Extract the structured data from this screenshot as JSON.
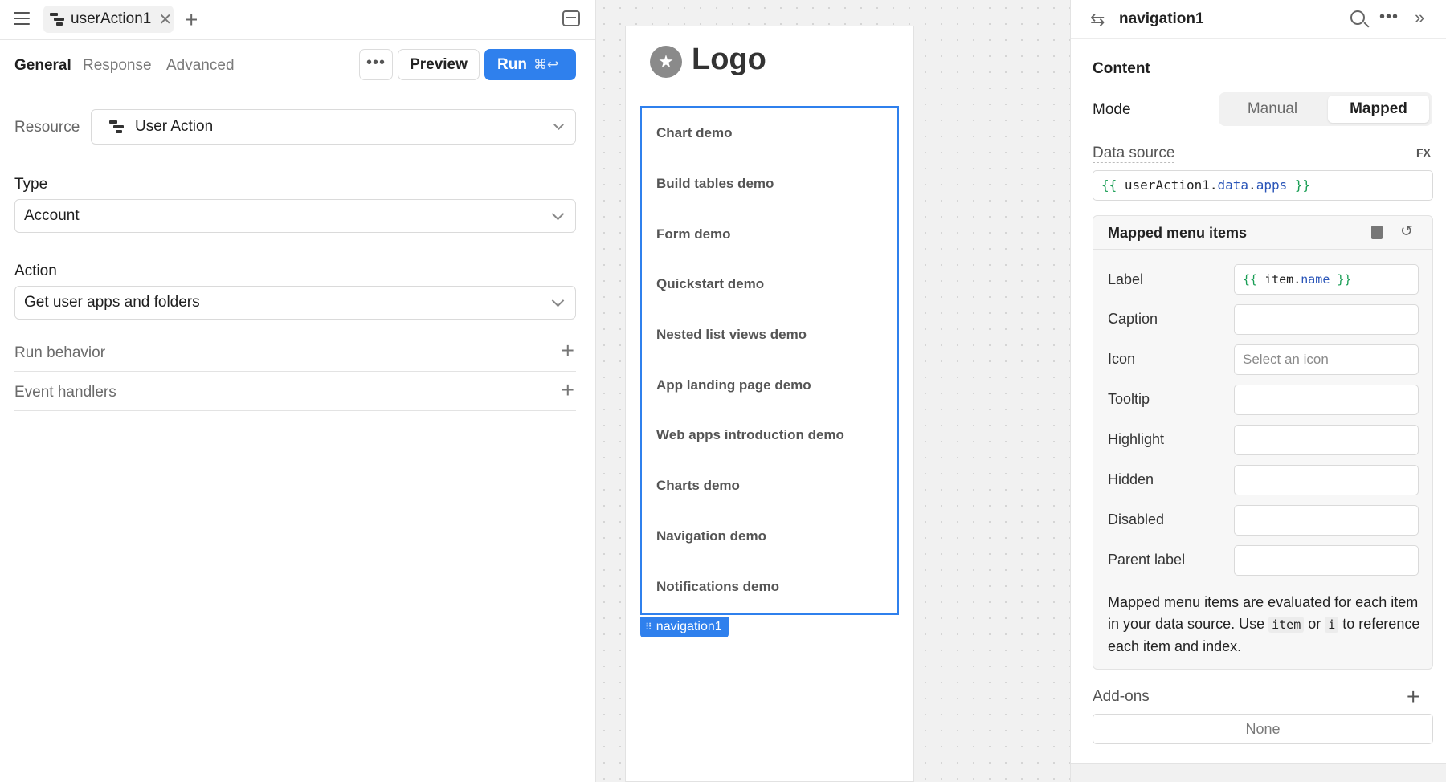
{
  "left_panel": {
    "file_tab": {
      "name": "userAction1",
      "close": "✕",
      "new_tab": "+"
    },
    "subtabs": [
      "General",
      "Response",
      "Advanced"
    ],
    "more_label": "•••",
    "preview_label": "Preview",
    "run_label": "Run",
    "run_shortcut": "⌘↩",
    "resource": {
      "label": "Resource",
      "value": "User Action"
    },
    "type": {
      "label": "Type",
      "value": "Account"
    },
    "action": {
      "label": "Action",
      "value": "Get user apps and folders"
    },
    "sections": [
      "Run behavior",
      "Event handlers"
    ]
  },
  "canvas": {
    "logo_text": "Logo",
    "logo_glyph": "★",
    "nav_items": [
      "Chart demo",
      "Build tables demo",
      "Form demo",
      "Quickstart demo",
      "Nested list views demo",
      "App landing page demo",
      "Web apps introduction demo",
      "Charts demo",
      "Navigation demo",
      "Notifications demo"
    ],
    "selected_tag": "navigation1",
    "selected_tag_grip": "⠿"
  },
  "inspector": {
    "title": "navigation1",
    "content_heading": "Content",
    "mode_label": "Mode",
    "mode_options": [
      "Manual",
      "Mapped"
    ],
    "mode_selected": "Mapped",
    "data_source_label": "Data source",
    "fx_label": "FX",
    "data_source": {
      "open": "{{",
      "id": "userAction1",
      "dot1": ".",
      "p1": "data",
      "dot2": ".",
      "p2": "apps",
      "close": "}}"
    },
    "mapped_heading": "Mapped menu items",
    "fields": [
      {
        "label": "Label",
        "value": "",
        "placeholder": ""
      },
      {
        "label": "Caption",
        "value": "",
        "placeholder": ""
      },
      {
        "label": "Icon",
        "value": "",
        "placeholder": "Select an icon"
      },
      {
        "label": "Tooltip",
        "value": "",
        "placeholder": ""
      },
      {
        "label": "Highlight",
        "value": "",
        "placeholder": ""
      },
      {
        "label": "Hidden",
        "value": "",
        "placeholder": ""
      },
      {
        "label": "Disabled",
        "value": "",
        "placeholder": ""
      },
      {
        "label": "Parent label",
        "value": "",
        "placeholder": ""
      }
    ],
    "label_code": {
      "open": "{{",
      "id": "item",
      "dot": ".",
      "prop": "name",
      "close": "}}"
    },
    "help": {
      "part1": "Mapped menu items are evaluated for each item in your data source. Use ",
      "code1": "item",
      "part2": " or ",
      "code2": "i",
      "part3": " to reference each item and index."
    },
    "addons_label": "Add-ons",
    "addons_value": "None"
  },
  "colors": {
    "accent": "#2f80ed",
    "code_brace": "#1a9e55",
    "code_prop": "#2a55b8"
  },
  "icons": [
    "hamburger-icon",
    "resource-icon",
    "close-icon",
    "plus-icon",
    "collapse-panel-icon",
    "star-icon",
    "navigation-icon",
    "search-icon",
    "more-icon",
    "expand-icon",
    "book-icon",
    "reset-icon"
  ]
}
